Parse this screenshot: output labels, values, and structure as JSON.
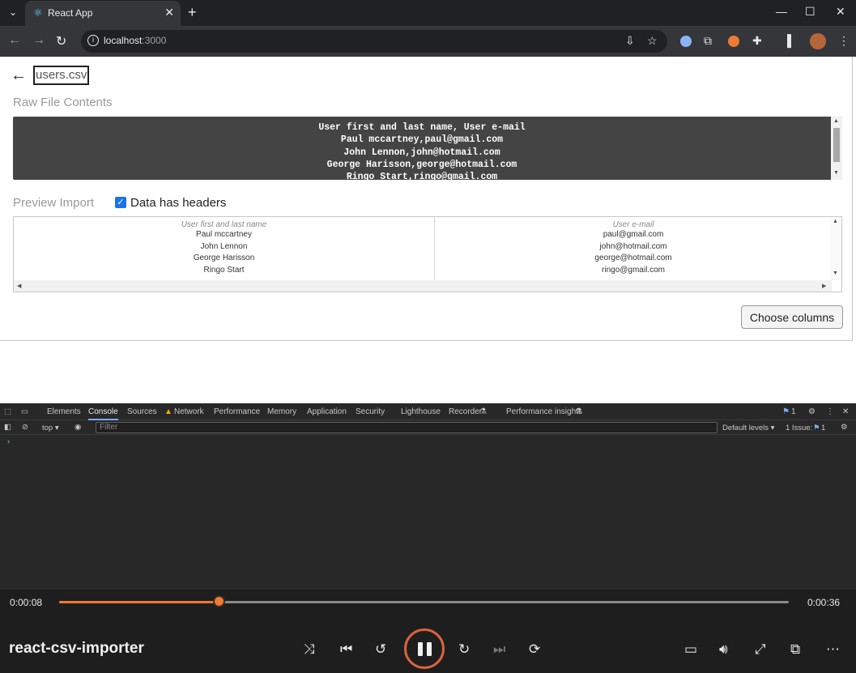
{
  "browser": {
    "tab_title": "React App",
    "url_host": "localhost",
    "url_port": ":3000"
  },
  "page": {
    "filename": "users.csv",
    "raw_heading": "Raw File Contents",
    "raw_lines": "User first and last name, User e-mail\nPaul mccartney,paul@gmail.com\nJohn Lennon,john@hotmail.com\nGeorge Harisson,george@hotmail.com\nRingo Start,ringo@gmail.com",
    "preview_heading": "Preview Import",
    "headers_checkbox_label": "Data has headers",
    "headers_checked": true,
    "table": {
      "columns": [
        "User first and last name",
        "User e-mail"
      ],
      "rows": [
        [
          "Paul mccartney",
          "paul@gmail.com"
        ],
        [
          "John Lennon",
          "john@hotmail.com"
        ],
        [
          "George Harisson",
          "george@hotmail.com"
        ],
        [
          "Ringo Start",
          "ringo@gmail.com"
        ]
      ]
    },
    "choose_button": "Choose columns"
  },
  "devtools": {
    "tabs": [
      "Elements",
      "Console",
      "Sources",
      "Network",
      "Performance",
      "Memory",
      "Application",
      "Security",
      "Lighthouse",
      "Recorder",
      "Performance insights"
    ],
    "active_tab": "Console",
    "issues_count": "1",
    "context": "top",
    "filter_placeholder": "Filter",
    "levels": "Default levels",
    "issue_text": "1 Issue:",
    "issue_badge": "1",
    "prompt": "›"
  },
  "player": {
    "current_time": "0:00:08",
    "total_time": "0:00:36",
    "progress": 0.22,
    "title": "react-csv-importer"
  },
  "colors": {
    "accent": "#ee7a34",
    "checkbox": "#1a73e8"
  }
}
